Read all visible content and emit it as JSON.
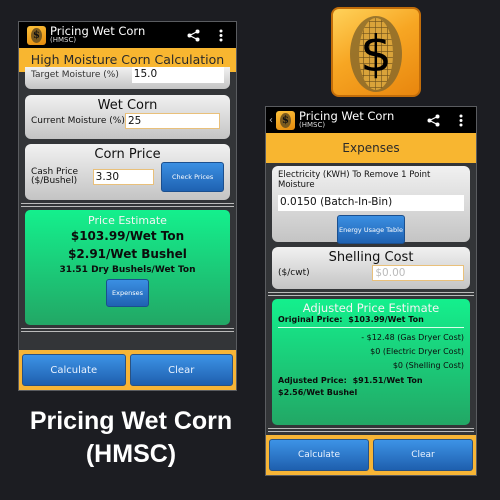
{
  "promo": {
    "line1": "Pricing Wet Corn",
    "line2": "(HMSC)"
  },
  "app_icon": {
    "symbol": "$",
    "name": "corn-dollar-icon"
  },
  "left_screen": {
    "actionbar": {
      "title": "Pricing Wet Corn",
      "subtitle": "(HMSC)",
      "share_icon": "share-icon",
      "menu_icon": "overflow-menu-icon"
    },
    "banner": "High Moisture Corn Calculation",
    "target_moisture": {
      "label": "Target Moisture (%)",
      "value": "15.0"
    },
    "wet_corn": {
      "title": "Wet Corn",
      "label": "Current Moisture (%)",
      "value": "25"
    },
    "corn_price": {
      "title": "Corn Price",
      "label_line1": "Cash Price",
      "label_line2": "($/Bushel)",
      "value": "3.30",
      "button": "Check Prices"
    },
    "estimate": {
      "title": "Price Estimate",
      "per_ton": "$103.99/Wet Ton",
      "per_bushel": "$2.91/Wet Bushel",
      "dry_bushels": "31.51 Dry Bushels/Wet Ton",
      "button": "Expenses"
    },
    "bottom": {
      "calculate": "Calculate",
      "clear": "Clear"
    }
  },
  "right_screen": {
    "actionbar": {
      "back": "‹",
      "title": "Pricing Wet Corn",
      "subtitle": "(HMSC)",
      "share_icon": "share-icon",
      "menu_icon": "overflow-menu-icon"
    },
    "banner": "Expenses",
    "electricity": {
      "label": "Electricity (KWH) To Remove 1 Point Moisture",
      "value": "0.0150 (Batch-In-Bin)",
      "button": "Energy Usage Table"
    },
    "shelling": {
      "title": "Shelling Cost",
      "label": "($/cwt)",
      "placeholder": "$0.00"
    },
    "adjusted": {
      "title": "Adjusted Price Estimate",
      "original_label": "Original Price:",
      "original_value": "$103.99/Wet Ton",
      "costs": [
        "- $12.48 (Gas Dryer Cost)",
        "$0 (Electric Dryer Cost)",
        "$0 (Shelling Cost)"
      ],
      "adjusted_label": "Adjusted Price:",
      "adjusted_value": "$91.51/Wet Ton",
      "adjusted_bushel": "$2.56/Wet Bushel"
    },
    "bottom": {
      "calculate": "Calculate",
      "clear": "Clear"
    }
  }
}
